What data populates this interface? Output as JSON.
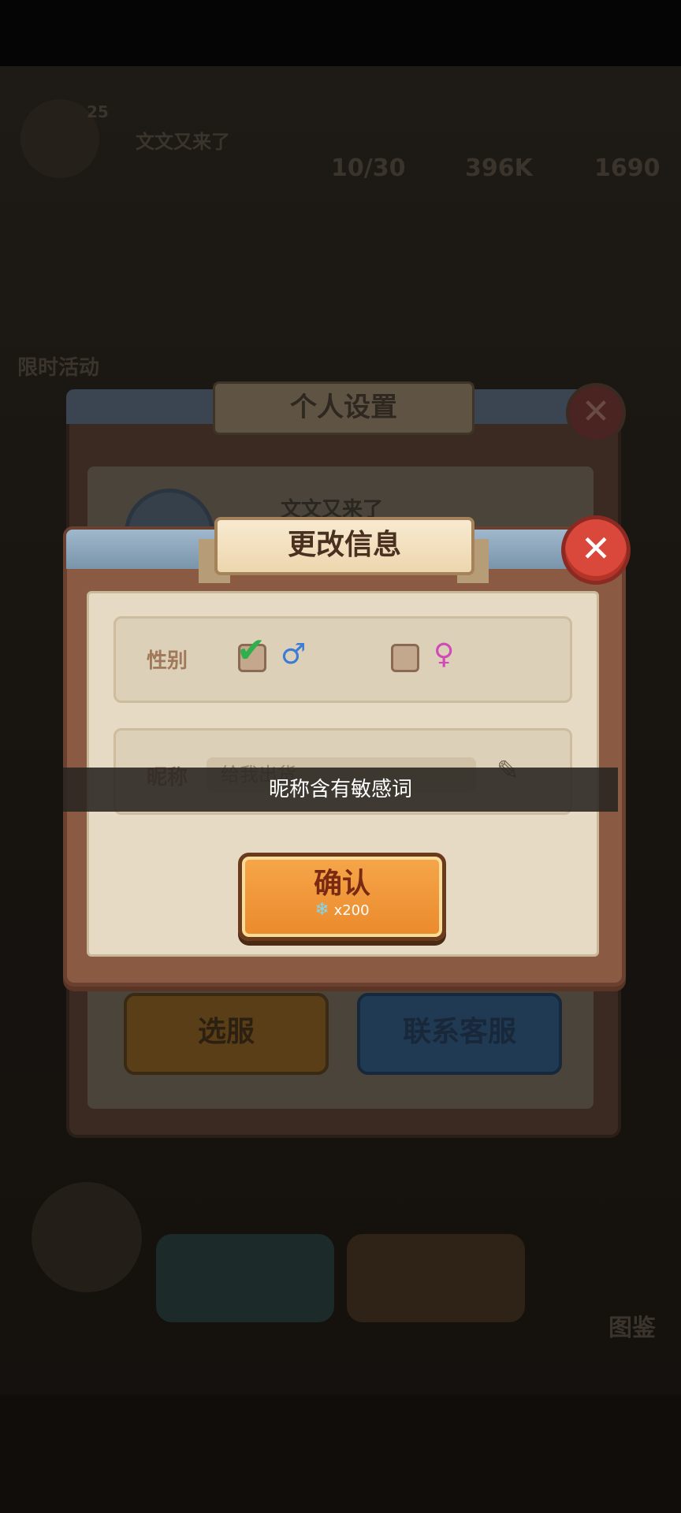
{
  "background_hud": {
    "level": "25",
    "player_name": "文文又来了",
    "stamina": "10/30",
    "coins": "396K",
    "gems": "1690",
    "event_label": "限时活动",
    "bottom_label": "图鉴"
  },
  "back_panel": {
    "title": "个人设置",
    "nickname": "文文又来了",
    "server_button": "选服",
    "support_button": "联系客服"
  },
  "dialog": {
    "title": "更改信息",
    "close_glyph": "✕",
    "gender_label": "性别",
    "male_checked": true,
    "female_checked": false,
    "male_symbol": "♂",
    "female_symbol": "♀",
    "check_glyph": "✔",
    "nickname_label": "昵称",
    "nickname_value": "给我出货",
    "pen_glyph": "✎",
    "confirm_label": "确认",
    "confirm_cost": "x200",
    "gem_glyph": "❄"
  },
  "toast": {
    "message": "昵称含有敏感词"
  }
}
